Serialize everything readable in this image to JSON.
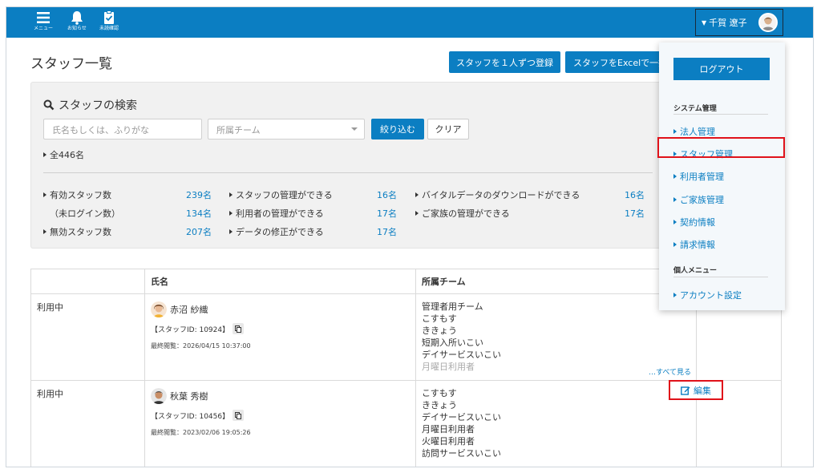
{
  "topbar": {
    "menu_label": "メニュー",
    "notify_label": "お知らせ",
    "unconfirmed_label": "未読確認",
    "user_name": "千賀 遼子",
    "bg_color": "#0b7ec2"
  },
  "page": {
    "title": "スタッフ一覧",
    "register_one_label": "スタッフを１人ずつ登録",
    "register_excel_label": "スタッフをExcelで一括"
  },
  "search": {
    "title": "スタッフの検索",
    "name_placeholder": "氏名もしくは、ふりがな",
    "team_placeholder": "所属チーム",
    "filter_label": "絞り込む",
    "clear_label": "クリア",
    "total": "全446名"
  },
  "stats": {
    "active": {
      "label": "有効スタッフ数",
      "value": "239名"
    },
    "not_logged_in": {
      "label": "（未ログイン数）",
      "value": "134名"
    },
    "inactive": {
      "label": "無効スタッフ数",
      "value": "207名"
    },
    "staff_mgmt": {
      "label": "スタッフの管理ができる",
      "value": "16名"
    },
    "user_mgmt": {
      "label": "利用者の管理ができる",
      "value": "17名"
    },
    "data_fix": {
      "label": "データの修正ができる",
      "value": "17名"
    },
    "vital_dl": {
      "label": "バイタルデータのダウンロードができる",
      "value": "16名"
    },
    "family_mgmt": {
      "label": "ご家族の管理ができる",
      "value": "17名"
    }
  },
  "table": {
    "headers": [
      "",
      "氏名",
      "所属チーム",
      ""
    ],
    "rows": [
      {
        "status": "利用中",
        "name": "赤沼 紗織",
        "staff_id": "【スタッフID: 10924】",
        "last_view": "最終閲覧：2026/04/15 10:37:00",
        "teams": [
          "管理者用チーム",
          "こすもす",
          "ききょう",
          "短期入所いこい",
          "デイサービスいこい"
        ],
        "teams_dim": "月曜日利用者",
        "see_all": "…すべて見る"
      },
      {
        "status": "利用中",
        "name": "秋葉 秀樹",
        "staff_id": "【スタッフID: 10456】",
        "last_view": "最終閲覧：2023/02/06 19:05:26",
        "teams": [
          "こすもす",
          "ききょう",
          "デイサービスいこい",
          "月曜日利用者",
          "火曜日利用者",
          "訪問サービスいこい"
        ],
        "edit_label": "編集"
      }
    ]
  },
  "menu": {
    "logout_label": "ログアウト",
    "system_section": "システム管理",
    "items": [
      "法人管理",
      "スタッフ管理",
      "利用者管理",
      "ご家族管理",
      "契約情報",
      "請求情報"
    ],
    "personal_section": "個人メニュー",
    "account_label": "アカウント設定",
    "highlight_color": "#e0121a"
  }
}
